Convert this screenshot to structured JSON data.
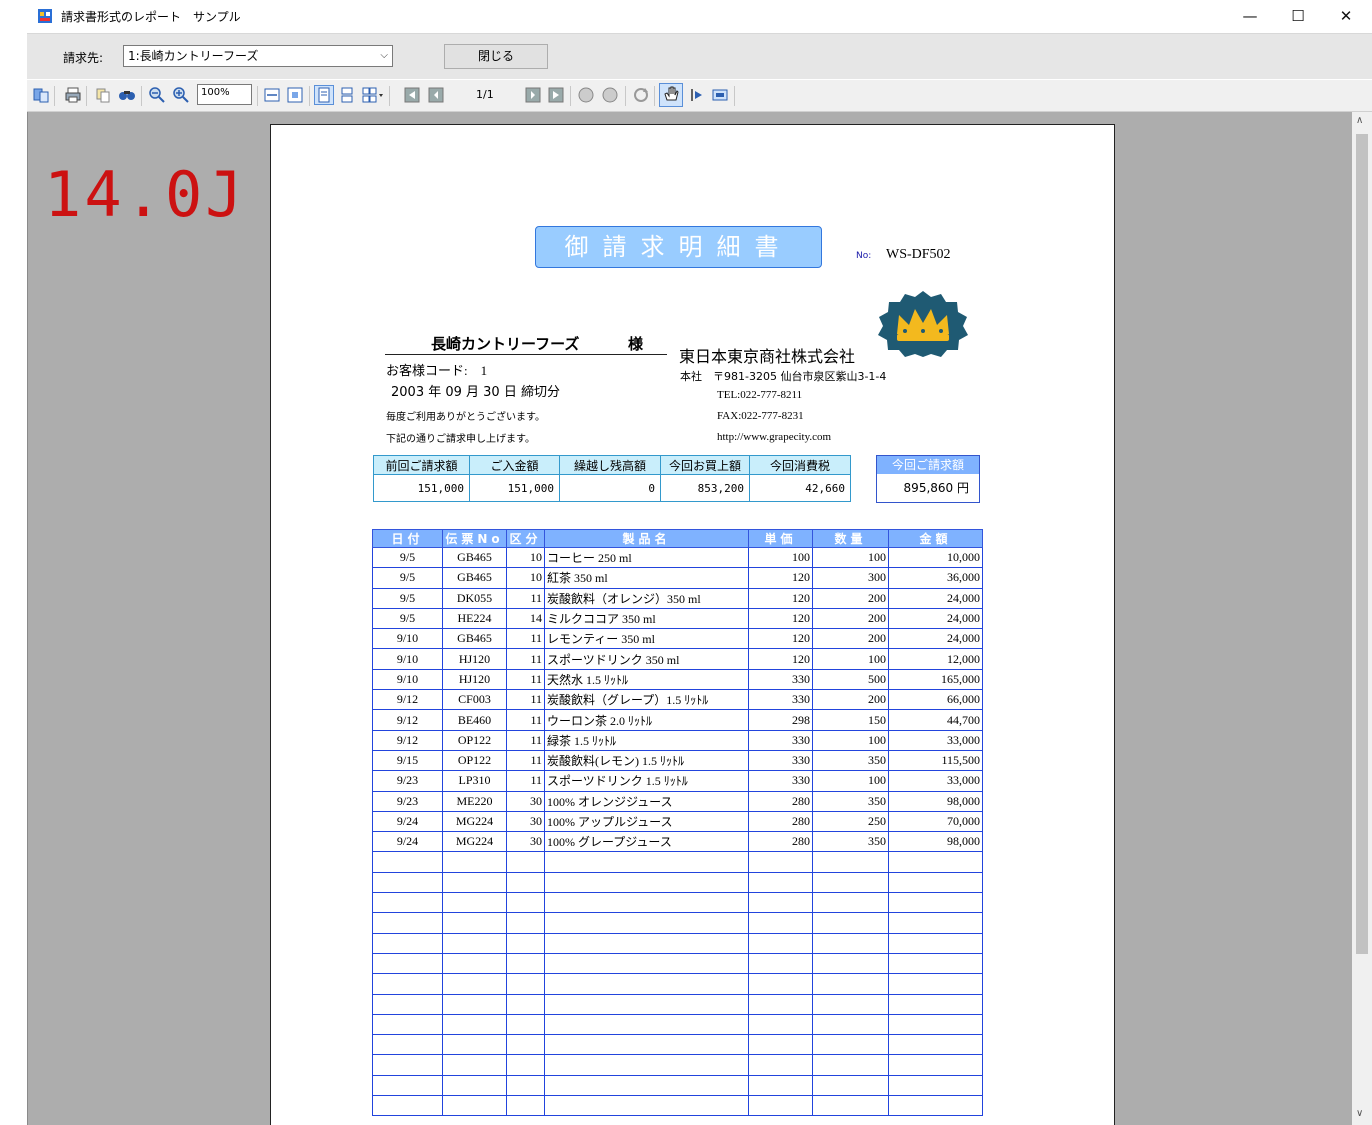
{
  "window": {
    "title": "請求書形式のレポート　サンプル",
    "minimize": "—",
    "maximize": "☐",
    "close": "✕"
  },
  "filter": {
    "label": "請求先:",
    "selected": "1:長崎カントリーフーズ",
    "close_button": "閉じる"
  },
  "toolbar": {
    "zoom": "100%",
    "page": "1/1"
  },
  "viewer": {
    "watermark": "14.0J"
  },
  "invoice": {
    "title": "御請求明細書",
    "no_label": "No:",
    "no_value": "WS-DF502",
    "customer_name": "長崎カントリーフーズ",
    "honorific": "様",
    "customer_code": "お客様コード:　1",
    "closing_date": "2003 年 09 月 30 日 締切分",
    "greeting1": "毎度ご利用ありがとうございます。",
    "greeting2": "下記の通りご請求申し上げます。",
    "company": {
      "name": "東日本東京商社株式会社",
      "address": "本社　〒981-3205 仙台市泉区紫山3-1-4",
      "tel": "TEL:022-777-8211",
      "fax": "FAX:022-777-8231",
      "url": "http://www.grapecity.com"
    },
    "summary": {
      "headers": [
        "前回ご請求額",
        "ご入金額",
        "繰越し残高額",
        "今回お買上額",
        "今回消費税"
      ],
      "values": [
        "151,000",
        "151,000",
        "0",
        "853,200",
        "42,660"
      ],
      "total_header": "今回ご請求額",
      "total_value": "895,860 円"
    },
    "detail_headers": [
      "日付",
      "伝票No",
      "区分",
      "製品名",
      "単価",
      "数量",
      "金額"
    ],
    "rows": [
      [
        "9/5",
        "GB465",
        "10",
        "コーヒー 250 ml",
        "100",
        "100",
        "10,000"
      ],
      [
        "9/5",
        "GB465",
        "10",
        "紅茶 350 ml",
        "120",
        "300",
        "36,000"
      ],
      [
        "9/5",
        "DK055",
        "11",
        "炭酸飲料（オレンジ）350 ml",
        "120",
        "200",
        "24,000"
      ],
      [
        "9/5",
        "HE224",
        "14",
        "ミルクココア 350 ml",
        "120",
        "200",
        "24,000"
      ],
      [
        "9/10",
        "GB465",
        "11",
        "レモンティー 350 ml",
        "120",
        "200",
        "24,000"
      ],
      [
        "9/10",
        "HJ120",
        "11",
        "スポーツドリンク 350 ml",
        "120",
        "100",
        "12,000"
      ],
      [
        "9/10",
        "HJ120",
        "11",
        "天然水 1.5 ﾘｯﾄﾙ",
        "330",
        "500",
        "165,000"
      ],
      [
        "9/12",
        "CF003",
        "11",
        "炭酸飲料（グレープ）1.5 ﾘｯﾄﾙ",
        "330",
        "200",
        "66,000"
      ],
      [
        "9/12",
        "BE460",
        "11",
        "ウーロン茶 2.0 ﾘｯﾄﾙ",
        "298",
        "150",
        "44,700"
      ],
      [
        "9/12",
        "OP122",
        "11",
        "緑茶 1.5 ﾘｯﾄﾙ",
        "330",
        "100",
        "33,000"
      ],
      [
        "9/15",
        "OP122",
        "11",
        "炭酸飲料(レモン) 1.5 ﾘｯﾄﾙ",
        "330",
        "350",
        "115,500"
      ],
      [
        "9/23",
        "LP310",
        "11",
        "スポーツドリンク 1.5 ﾘｯﾄﾙ",
        "330",
        "100",
        "33,000"
      ],
      [
        "9/23",
        "ME220",
        "30",
        "100% オレンジジュース",
        "280",
        "350",
        "98,000"
      ],
      [
        "9/24",
        "MG224",
        "30",
        "100% アップルジュース",
        "280",
        "250",
        "70,000"
      ],
      [
        "9/24",
        "MG224",
        "30",
        "100% グレープジュース",
        "280",
        "350",
        "98,000"
      ]
    ]
  }
}
